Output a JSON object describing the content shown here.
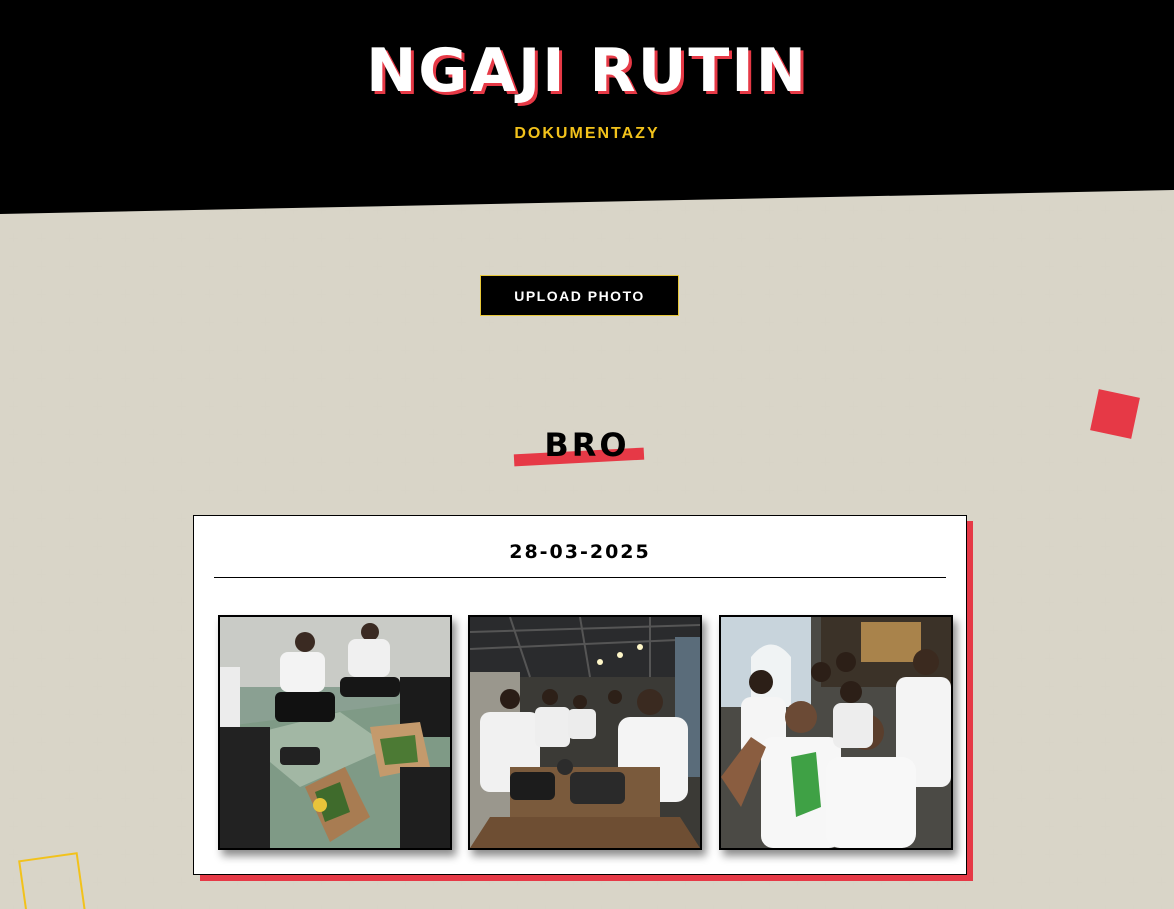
{
  "header": {
    "title": "NGAJI RUTIN",
    "subtitle": "DOKUMENTAZY"
  },
  "actions": {
    "upload_label": "UPLOAD PHOTO"
  },
  "section": {
    "heading": "BRO"
  },
  "album": {
    "date": "28-03-2025",
    "photos": [
      {
        "name": "photo-group-eating-floor"
      },
      {
        "name": "photo-group-cafe-table"
      },
      {
        "name": "photo-group-selfie"
      }
    ]
  },
  "colors": {
    "background": "#e9e6dc",
    "header": "#000000",
    "accent_red": "#e63946",
    "accent_yellow": "#f2c21b",
    "card": "#ffffff"
  }
}
